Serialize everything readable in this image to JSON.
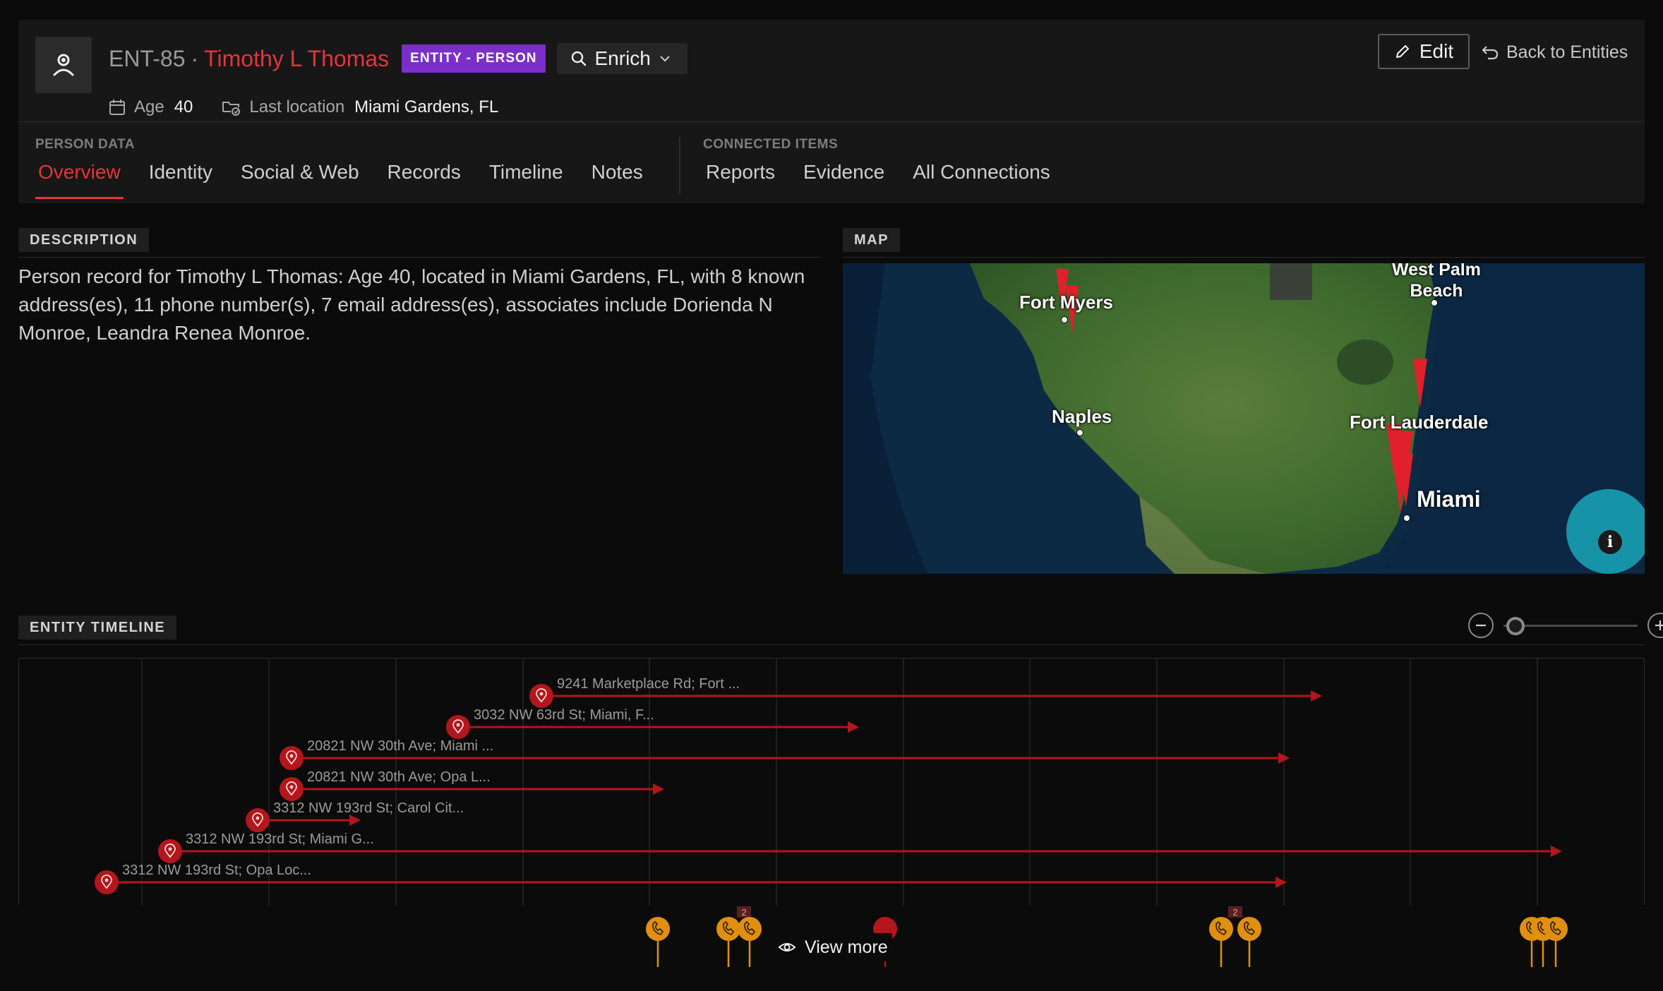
{
  "header": {
    "entity_id": "ENT-85",
    "separator": "·",
    "name": "Timothy L Thomas",
    "badge": "ENTITY - PERSON",
    "enrich_label": "Enrich",
    "age_label": "Age",
    "age_value": "40",
    "location_label": "Last location",
    "location_value": "Miami Gardens, FL",
    "edit_label": "Edit",
    "back_label": "Back to Entities"
  },
  "tabs": {
    "person_group_label": "PERSON DATA",
    "person_tabs": [
      "Overview",
      "Identity",
      "Social & Web",
      "Records",
      "Timeline",
      "Notes"
    ],
    "active_tab": "Overview",
    "connected_group_label": "CONNECTED ITEMS",
    "connected_tabs": [
      "Reports",
      "Evidence",
      "All Connections"
    ]
  },
  "description": {
    "label": "DESCRIPTION",
    "text": "Person record for Timothy L Thomas: Age 40, located in Miami Gardens, FL, with 8 known address(es), 11 phone number(s), 7 email address(es), associates include Dorienda N Monroe, Leandra Renea Monroe."
  },
  "map": {
    "label": "MAP",
    "cities": [
      "West Palm Beach",
      "Fort Myers",
      "Naples",
      "Fort Lauderdale",
      "Miami"
    ],
    "info_icon": "info-icon",
    "colors": {
      "land": "#3f6a2e",
      "water": "#0e2f4d",
      "marker": "#e0202a"
    }
  },
  "timeline": {
    "label": "ENTITY TIMELINE",
    "zoom_out_icon": "minus-icon",
    "zoom_in_icon": "plus-icon",
    "zoom_level": 0.0,
    "address_events": [
      "9241 Marketplace Rd; Fort ...",
      "3032 NW 63rd St; Miami, F...",
      "20821 NW 30th Ave; Miami ...",
      "20821 NW 30th Ave; Opa L...",
      "3312 NW 193rd St; Carol Cit...",
      "3312 NW 193rd St; Miami G...",
      "3312 NW 193rd St; Opa Loc..."
    ],
    "cluster_counts": [
      "2",
      "2"
    ],
    "view_more_label": "View more",
    "colors": {
      "address": "#b3161c",
      "phone": "#e0900f"
    }
  }
}
